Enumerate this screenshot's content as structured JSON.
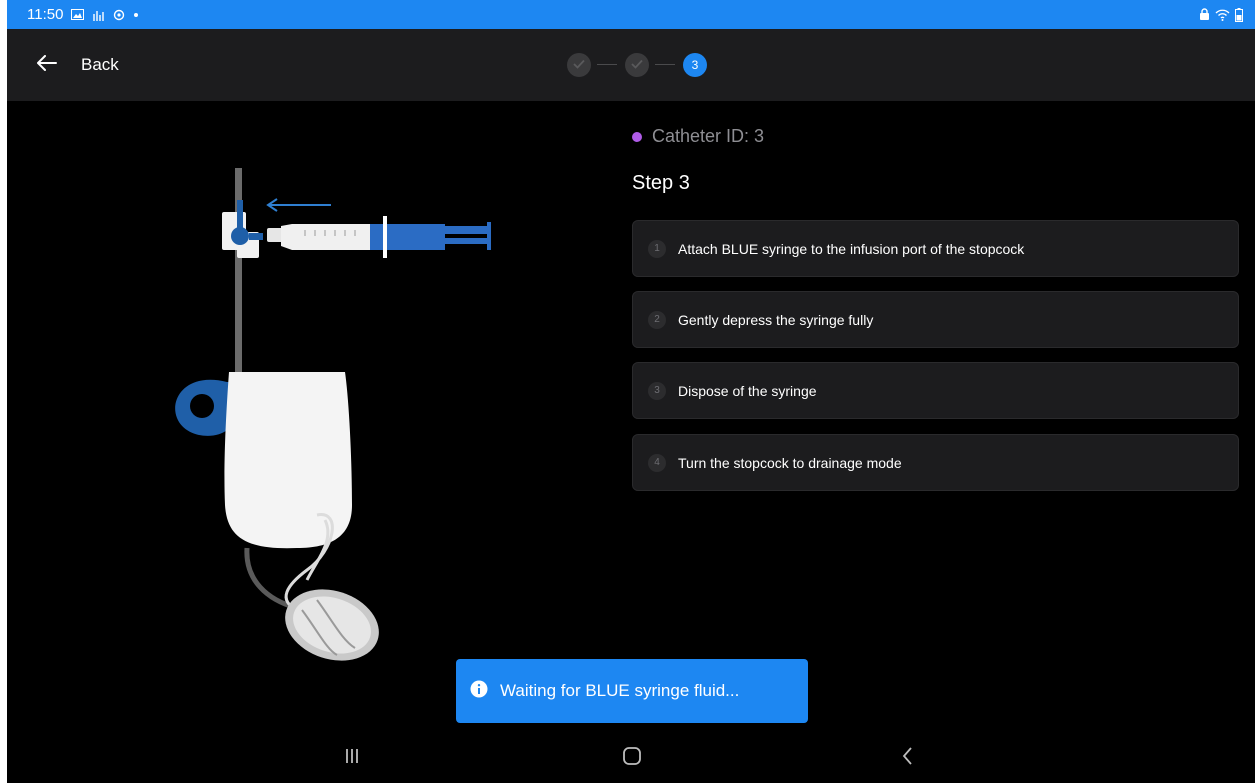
{
  "status_bar": {
    "time": "11:50",
    "left_icons": [
      "gallery-icon",
      "signal-activity-icon",
      "sync-icon",
      "dot-icon"
    ],
    "right_icons": [
      "lock-icon",
      "wifi-icon",
      "battery-icon"
    ],
    "color": "#1d87f2"
  },
  "app_bar": {
    "back_label": "Back",
    "stepper": {
      "steps": [
        {
          "state": "done",
          "label": ""
        },
        {
          "state": "done",
          "label": ""
        },
        {
          "state": "active",
          "label": "3"
        }
      ]
    }
  },
  "catheter": {
    "id_label": "Catheter ID: 3",
    "dot_color": "#b05ce8"
  },
  "step": {
    "title": "Step 3",
    "instructions": [
      {
        "number": "1",
        "text": "Attach BLUE syringe to the infusion port of the stopcock"
      },
      {
        "number": "2",
        "text": "Gently depress the syringe fully"
      },
      {
        "number": "3",
        "text": "Dispose of the syringe"
      },
      {
        "number": "4",
        "text": "Turn the stopcock to drainage mode"
      }
    ]
  },
  "toast": {
    "icon": "info-icon",
    "message": "Waiting for BLUE syringe fluid...",
    "color": "#1d87f2"
  },
  "nav_bar": {
    "icons": [
      "recent-apps-icon",
      "home-icon",
      "nav-back-icon"
    ]
  }
}
